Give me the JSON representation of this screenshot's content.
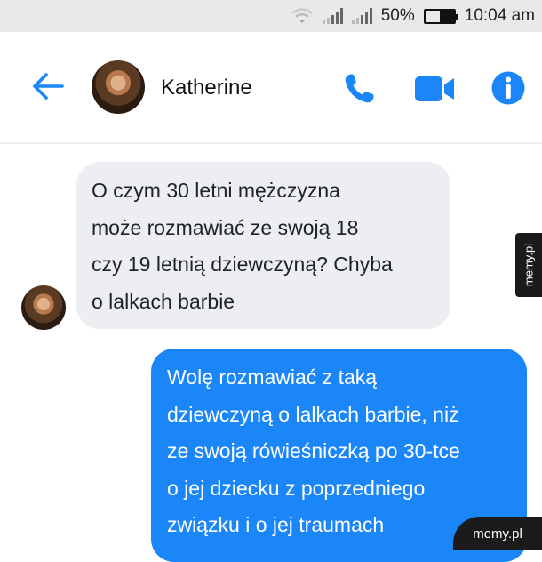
{
  "status_bar": {
    "battery_percent": "50%",
    "time": "10:04 am",
    "icons": [
      "wifi-icon",
      "signal-icon",
      "signal-icon",
      "battery-icon"
    ]
  },
  "header": {
    "contact_name": "Katherine",
    "icons": [
      "back-arrow-icon",
      "phone-icon",
      "video-camera-icon",
      "info-icon"
    ],
    "accent_color": "#1a86f8"
  },
  "messages": [
    {
      "direction": "incoming",
      "lines": [
        "O czym 30 letni mężczyzna",
        "może rozmawiać ze swoją 18",
        "czy 19 letnią dziewczyną? Chyba",
        "o lalkach barbie"
      ],
      "bubble_color": "#eceef1"
    },
    {
      "direction": "outgoing",
      "lines": [
        "Wolę rozmawiać z taką",
        "dziewczyną o lalkach barbie, niż",
        "ze swoją rówieśniczką po 30-tce",
        "o jej dziecku z poprzedniego",
        "związku i o jej traumach"
      ],
      "bubble_color": "#1a86f8"
    }
  ],
  "watermarks": {
    "side": "memy.pl",
    "bottom": "memy.pl"
  }
}
